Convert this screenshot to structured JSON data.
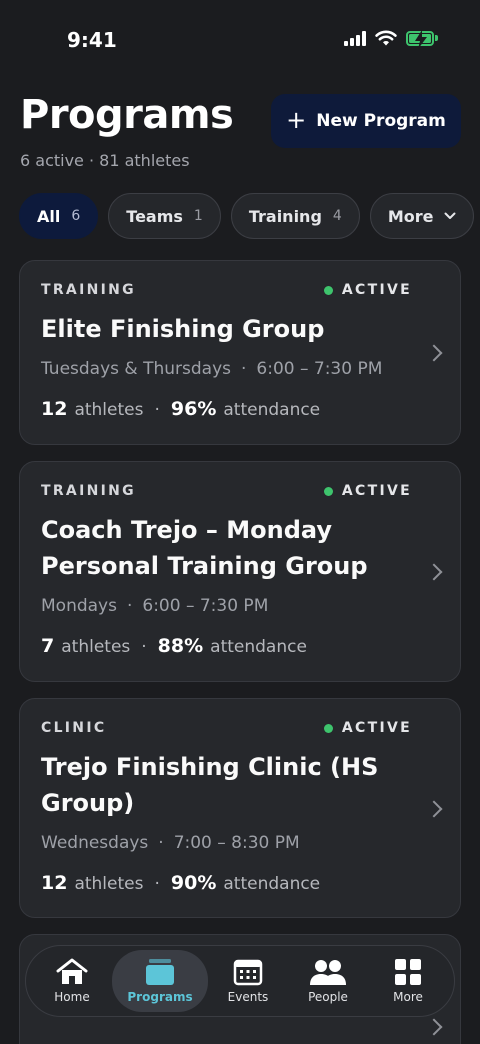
{
  "status_bar": {
    "time": "9:41"
  },
  "header": {
    "title": "Programs",
    "subtitle": "6 active · 81 athletes",
    "new_program_label": "New Program"
  },
  "filters": [
    {
      "label": "All",
      "count": "6",
      "active": true
    },
    {
      "label": "Teams",
      "count": "1"
    },
    {
      "label": "Training",
      "count": "4"
    },
    {
      "label": "More"
    }
  ],
  "programs": [
    {
      "category": "TRAINING",
      "status": "ACTIVE",
      "title": "Elite Finishing Group",
      "days": "Tuesdays & Thursdays",
      "time": "6:00 – 7:30 PM",
      "athletes": "12",
      "athletes_label": "athletes",
      "attendance": "96%",
      "attendance_label": "attendance"
    },
    {
      "category": "TRAINING",
      "status": "ACTIVE",
      "title": "Coach Trejo – Monday Personal Training Group",
      "days": "Mondays",
      "time": "6:00 – 7:30 PM",
      "athletes": "7",
      "athletes_label": "athletes",
      "attendance": "88%",
      "attendance_label": "attendance"
    },
    {
      "category": "CLINIC",
      "status": "ACTIVE",
      "title": "Trejo Finishing Clinic (HS Group)",
      "days": "Wednesdays",
      "time": "7:00 – 8:30 PM",
      "athletes": "12",
      "athletes_label": "athletes",
      "attendance": "90%",
      "attendance_label": "attendance"
    }
  ],
  "tab_bar": [
    {
      "label": "Home",
      "icon": "house-icon"
    },
    {
      "label": "Programs",
      "icon": "programs-stack-icon",
      "active": true
    },
    {
      "label": "Events",
      "icon": "calendar-icon"
    },
    {
      "label": "People",
      "icon": "people-icon"
    },
    {
      "label": "More",
      "icon": "grid-icon"
    }
  ],
  "colors": {
    "background": "#1b1c1f",
    "card": "#26282c",
    "primary_button": "#0e1a3a",
    "active_status": "#3ec46d",
    "active_tab": "#5cc5d8"
  }
}
